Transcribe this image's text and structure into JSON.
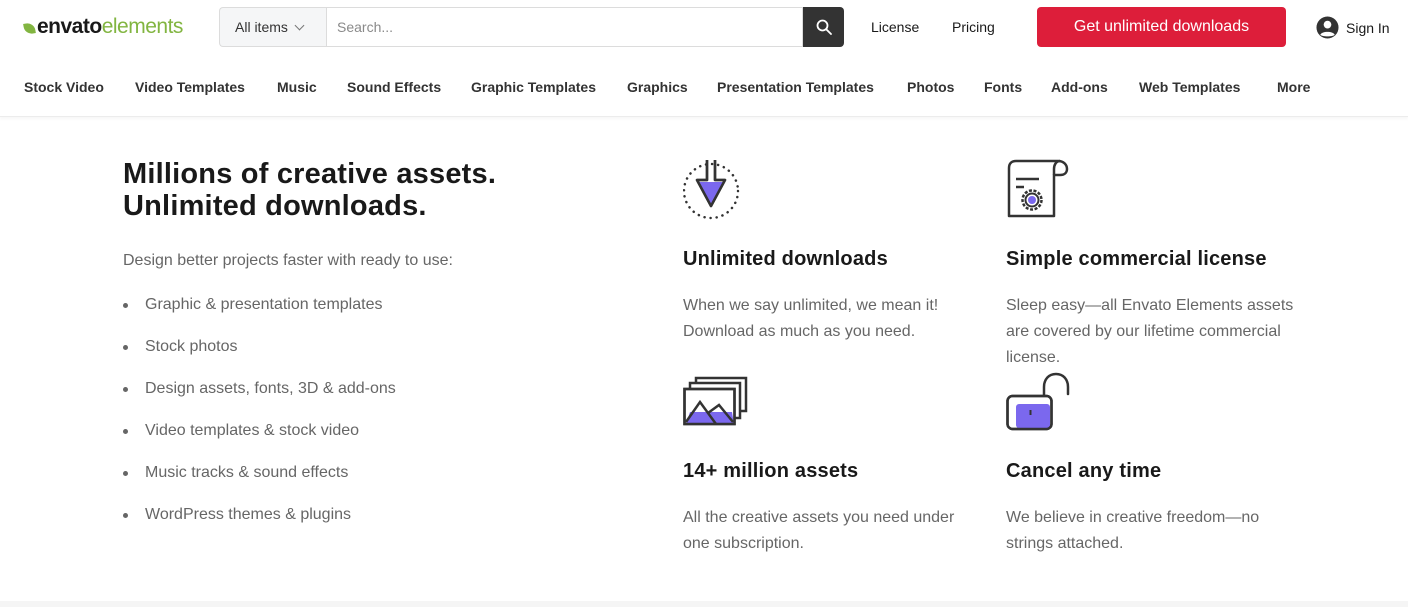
{
  "header": {
    "logo": {
      "part1": "envato",
      "part2": "elements"
    },
    "search": {
      "category": "All items",
      "placeholder": "Search..."
    },
    "links": {
      "license": "License",
      "pricing": "Pricing"
    },
    "cta_label": "Get unlimited downloads",
    "signin_label": "Sign In"
  },
  "categories": [
    "Stock Video",
    "Video Templates",
    "Music",
    "Sound Effects",
    "Graphic Templates",
    "Graphics",
    "Presentation Templates",
    "Photos",
    "Fonts",
    "Add-ons",
    "Web Templates",
    "More"
  ],
  "hero": {
    "title_line1": "Millions of creative assets.",
    "title_line2": "Unlimited downloads.",
    "subtitle": "Design better projects faster with ready to use:",
    "items": [
      "Graphic & presentation templates",
      "Stock photos",
      "Design assets, fonts, 3D & add-ons",
      "Video templates & stock video",
      "Music tracks & sound effects",
      "WordPress themes & plugins"
    ]
  },
  "features": [
    {
      "icon": "download-icon",
      "title": "Unlimited downloads",
      "text": "When we say unlimited, we mean it! Download as much as you need."
    },
    {
      "icon": "certificate-icon",
      "title": "Simple commercial license",
      "text": "Sleep easy—all Envato Elements assets are covered by our lifetime commercial license."
    },
    {
      "icon": "image-stack-icon",
      "title": "14+ million assets",
      "text": "All the creative assets you need under one subscription."
    },
    {
      "icon": "unlock-icon",
      "title": "Cancel any time",
      "text": "We believe in creative freedom—no strings attached."
    }
  ],
  "colors": {
    "brand_green": "#82b541",
    "cta_red": "#dd1e3a",
    "accent_purple": "#7b68ee",
    "text_dark": "#191919",
    "text_muted": "#666666"
  }
}
